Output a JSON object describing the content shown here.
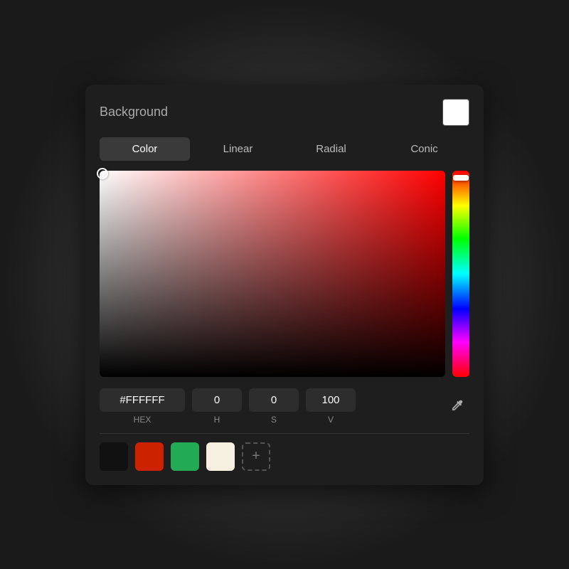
{
  "panel": {
    "title": "Background",
    "tabs": [
      {
        "label": "Color",
        "active": true
      },
      {
        "label": "Linear",
        "active": false
      },
      {
        "label": "Radial",
        "active": false
      },
      {
        "label": "Conic",
        "active": false
      }
    ],
    "preview_color": "#ffffff"
  },
  "color_picker": {
    "hex_value": "#FFFFFF",
    "h_value": "0",
    "s_value": "0",
    "v_value": "100",
    "hex_label": "HEX",
    "h_label": "H",
    "s_label": "S",
    "v_label": "V"
  },
  "swatches": [
    {
      "color": "#111111",
      "label": "black-swatch"
    },
    {
      "color": "#cc2200",
      "label": "red-swatch"
    },
    {
      "color": "#22aa55",
      "label": "green-swatch"
    },
    {
      "color": "#f5f0e0",
      "label": "cream-swatch"
    }
  ],
  "add_swatch_label": "+",
  "eyedropper_icon": "✒"
}
